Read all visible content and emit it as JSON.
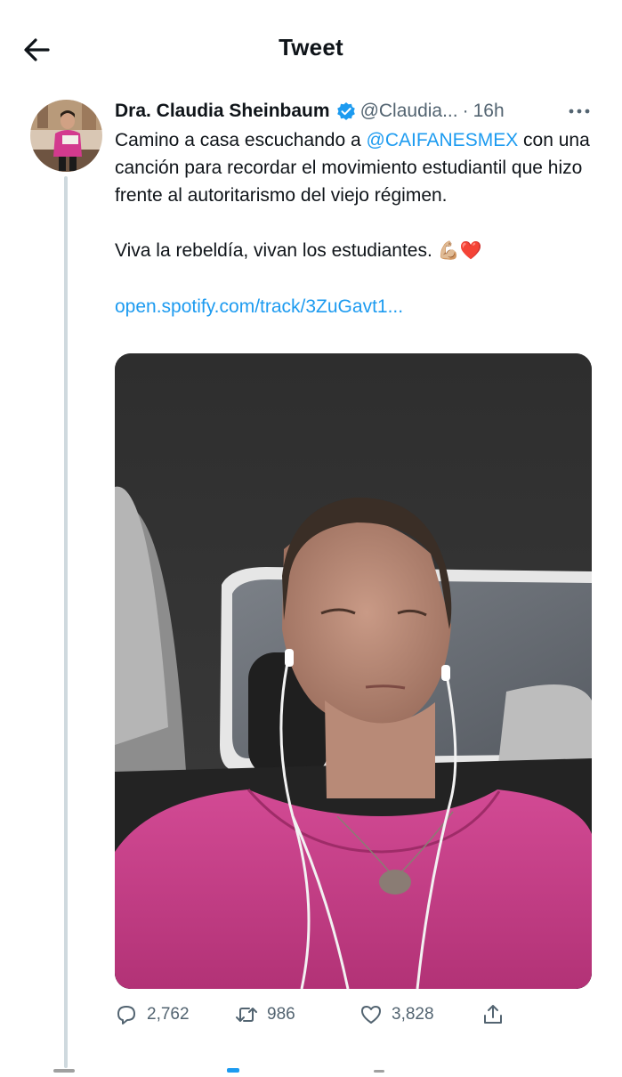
{
  "header": {
    "title": "Tweet"
  },
  "tweet": {
    "author_name": "Dra. Claudia Sheinbaum",
    "handle": "@Claudia...",
    "separator": "·",
    "time": "16h",
    "body": {
      "line1_prefix": "Camino a casa escuchando a ",
      "mention": "@CAIFANESMEX",
      "line1_rest": "con una canción para recordar el movimiento estudiantil que hizo frente al autoritarismo del viejo régimen.",
      "line2": "Viva la rebeldía, vivan los estudiantes.",
      "emoji_flex": "💪🏼",
      "emoji_heart": "❤️",
      "link": "open.spotify.com/track/3ZuGavt1..."
    },
    "stats": {
      "replies": "2,762",
      "retweets": "986",
      "likes": "3,828"
    }
  },
  "icons": {
    "back": "arrow-left-icon",
    "verified": "verified-badge-icon",
    "more": "more-dots-icon",
    "reply": "reply-icon",
    "retweet": "retweet-icon",
    "like": "like-icon",
    "share": "share-icon"
  },
  "colors": {
    "accent": "#1d9bf0",
    "secondary_text": "#536471",
    "thread_line": "#cfd9de",
    "shirt": "#c63b86"
  }
}
